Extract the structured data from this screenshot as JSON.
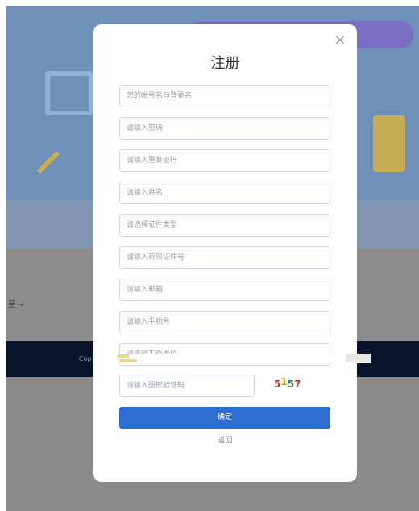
{
  "background": {
    "gray_snippet": "至 →",
    "nav_snippet": "Cop"
  },
  "dialog": {
    "title": "注册",
    "close_glyph": "×",
    "fields": {
      "account_placeholder": "您的帐号名与登录名",
      "password_placeholder": "请输入密码",
      "confirm_password_placeholder": "请输入重复密码",
      "name_placeholder": "请输入姓名",
      "id_type_placeholder": "请选择证件类型",
      "id_number_placeholder": "请输入有效证件号",
      "email_placeholder": "请输入邮箱",
      "phone_placeholder": "请输入手机号",
      "work_unit_placeholder": "请选择工作单位",
      "captcha_placeholder": "请输入图形验证码"
    },
    "captcha": {
      "d1": "5",
      "d2": "1",
      "d3": "5",
      "d4": "7",
      "colors": [
        "#c0392b",
        "#d4a017",
        "#2e7d32",
        "#c0392b"
      ]
    },
    "confirm_label": "确定",
    "back_label": "返回",
    "accent_color": "#2d6cd0"
  }
}
